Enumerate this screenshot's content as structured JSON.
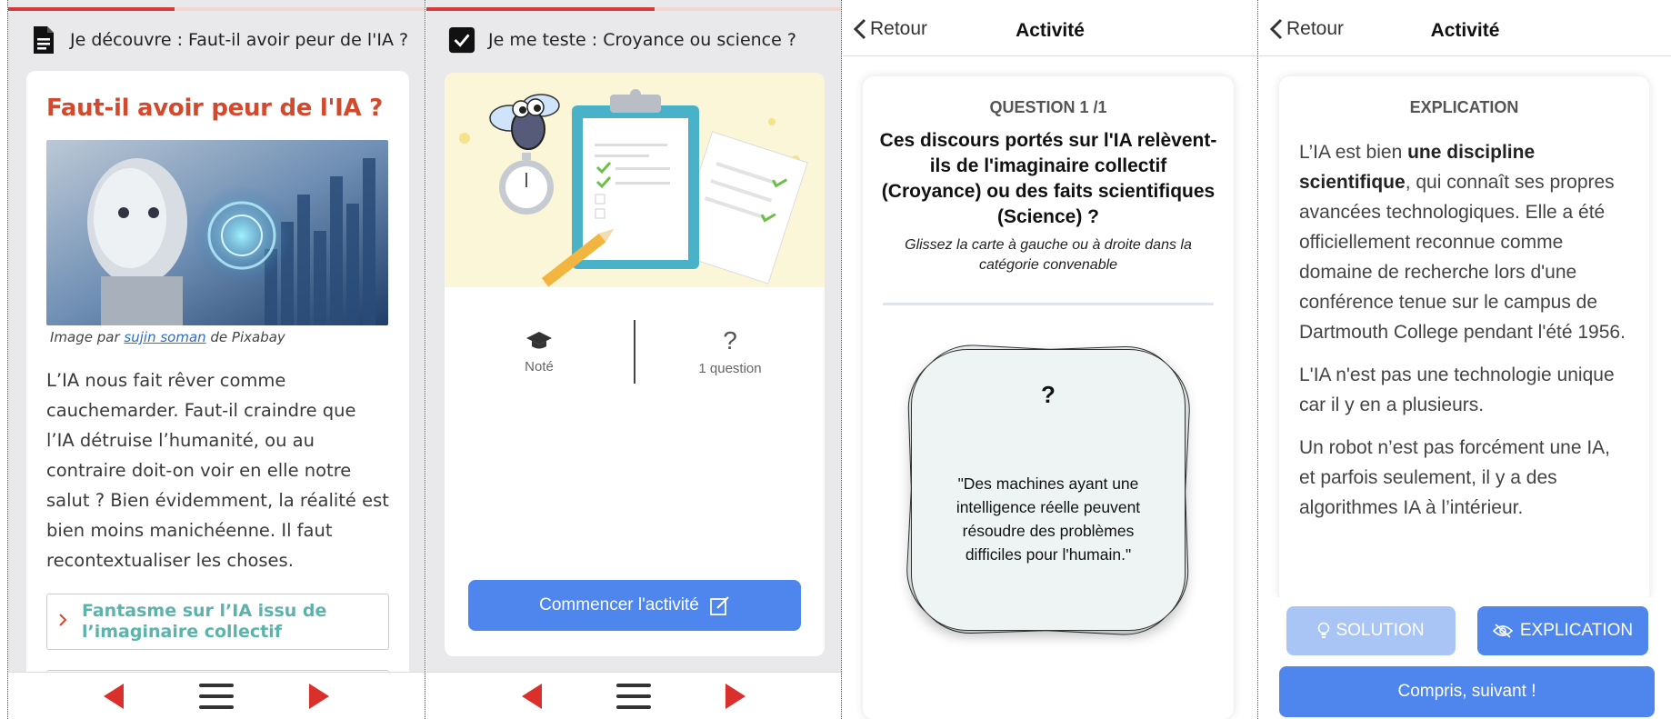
{
  "screen1": {
    "header_title": "Je découvre : Faut-il avoir peur de l'IA ?",
    "article_title": "Faut-il avoir peur de l'IA ?",
    "caption_prefix": "Image par ",
    "caption_link": "sujin soman",
    "caption_suffix": " de Pixabay",
    "body_text": "L’IA nous fait rêver comme cauchemarder. Faut-il craindre que l’IA détruise l’humanité, ou au contraire doit-on voir en elle notre salut ? Bien évidemment, la réalité est bien moins manichéenne. Il faut recontextualiser les choses.",
    "expander_label": "Fantasme sur l’IA issu de l’imaginaire collectif",
    "progress": 0.4
  },
  "screen2": {
    "header_title": "Je me teste : Croyance ou science ?",
    "stat_graded": "Noté",
    "stat_question_icon": "?",
    "stat_questions": "1 question",
    "start_button": "Commencer l'activité",
    "progress": 0.55
  },
  "screen3": {
    "back_label": "Retour",
    "title": "Activité",
    "question_number": "QUESTION 1 /1",
    "question_text": "Ces discours portés sur l'IA relèvent-ils de l'imaginaire collectif (Croyance) ou des faits scientifiques (Science) ?",
    "hint": "Glissez la carte à gauche ou à droite dans la catégorie convenable",
    "card_mark": "?",
    "card_statement": "\"Des machines ayant une intelligence réelle peuvent résoudre des problèmes difficiles pour l'humain.\""
  },
  "screen4": {
    "back_label": "Retour",
    "title": "Activité",
    "explication_title": "EXPLICATION",
    "para1_a": "L’IA est bien ",
    "para1_bold": "une discipline scientifique",
    "para1_b": ", qui connaît ses propres avancées technologiques. Elle a été officiellement reconnue comme domaine de recherche lors d'une conférence tenue sur le campus de Dartmouth College pendant l'été 1956.",
    "para2": "L'IA n'est pas une technologie unique car il y en a plusieurs.",
    "para3": "Un robot n’est pas forcément une IA, et parfois seulement, il y a des algorithmes IA à l’intérieur.",
    "solution_button": "SOLUTION",
    "explication_button": "EXPLICATION",
    "next_button": "Compris, suivant !"
  },
  "colors": {
    "accent_red": "#d24a2e",
    "nav_red": "#d9302b",
    "primary_blue": "#4f86ee",
    "teal": "#5bb3ac"
  },
  "icons": [
    "document-icon",
    "checkbox-icon",
    "arrow-left-icon",
    "hamburger-icon",
    "arrow-right-icon",
    "graduation-cap-icon",
    "edit-icon",
    "chevron-left-icon",
    "lightbulb-icon",
    "eye-slash-icon"
  ]
}
